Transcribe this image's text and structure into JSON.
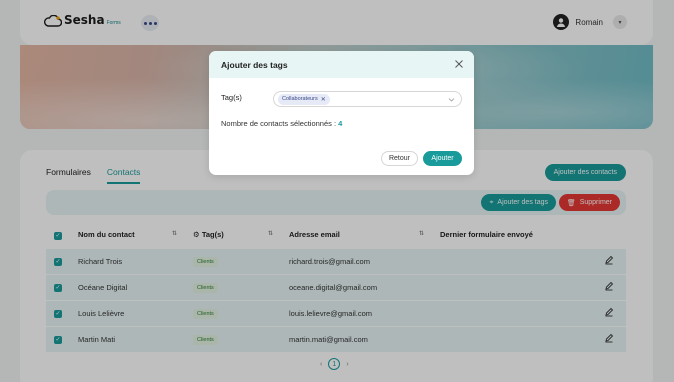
{
  "header": {
    "logo_text": "Sesha",
    "logo_sub": "Forms",
    "user_name": "Romain"
  },
  "tabs": [
    {
      "label": "Formulaires",
      "active": false
    },
    {
      "label": "Contacts",
      "active": true
    }
  ],
  "actions": {
    "add_contacts": "Ajouter des contacts",
    "add_tags": "Ajouter des tags",
    "delete": "Supprimer"
  },
  "table": {
    "headers": {
      "name": "Nom du contact",
      "tags": "Tag(s)",
      "email": "Adresse email",
      "last_form": "Dernier formulaire envoyé"
    },
    "rows": [
      {
        "name": "Richard Trois",
        "tag": "Clients",
        "email": "richard.trois@gmail.com",
        "last_form": "",
        "checked": true
      },
      {
        "name": "Océane Digital",
        "tag": "Clients",
        "email": "oceane.digital@gmail.com",
        "last_form": "",
        "checked": true
      },
      {
        "name": "Louis Lelièvre",
        "tag": "Clients",
        "email": "louis.lelievre@gmail.com",
        "last_form": "",
        "checked": true
      },
      {
        "name": "Martin Mati",
        "tag": "Clients",
        "email": "martin.mati@gmail.com",
        "last_form": "",
        "checked": true
      }
    ]
  },
  "pagination": {
    "current_page": "1"
  },
  "modal": {
    "title": "Ajouter des tags",
    "field_label": "Tag(s)",
    "selected_tag": "Collaborateurs",
    "count_label": "Nombre de contacts sélectionnés :",
    "count_value": "4",
    "back_label": "Retour",
    "submit_label": "Ajouter"
  },
  "colors": {
    "accent": "#1a9b9b",
    "danger": "#e53935",
    "row_bg": "#e8f5f5"
  }
}
